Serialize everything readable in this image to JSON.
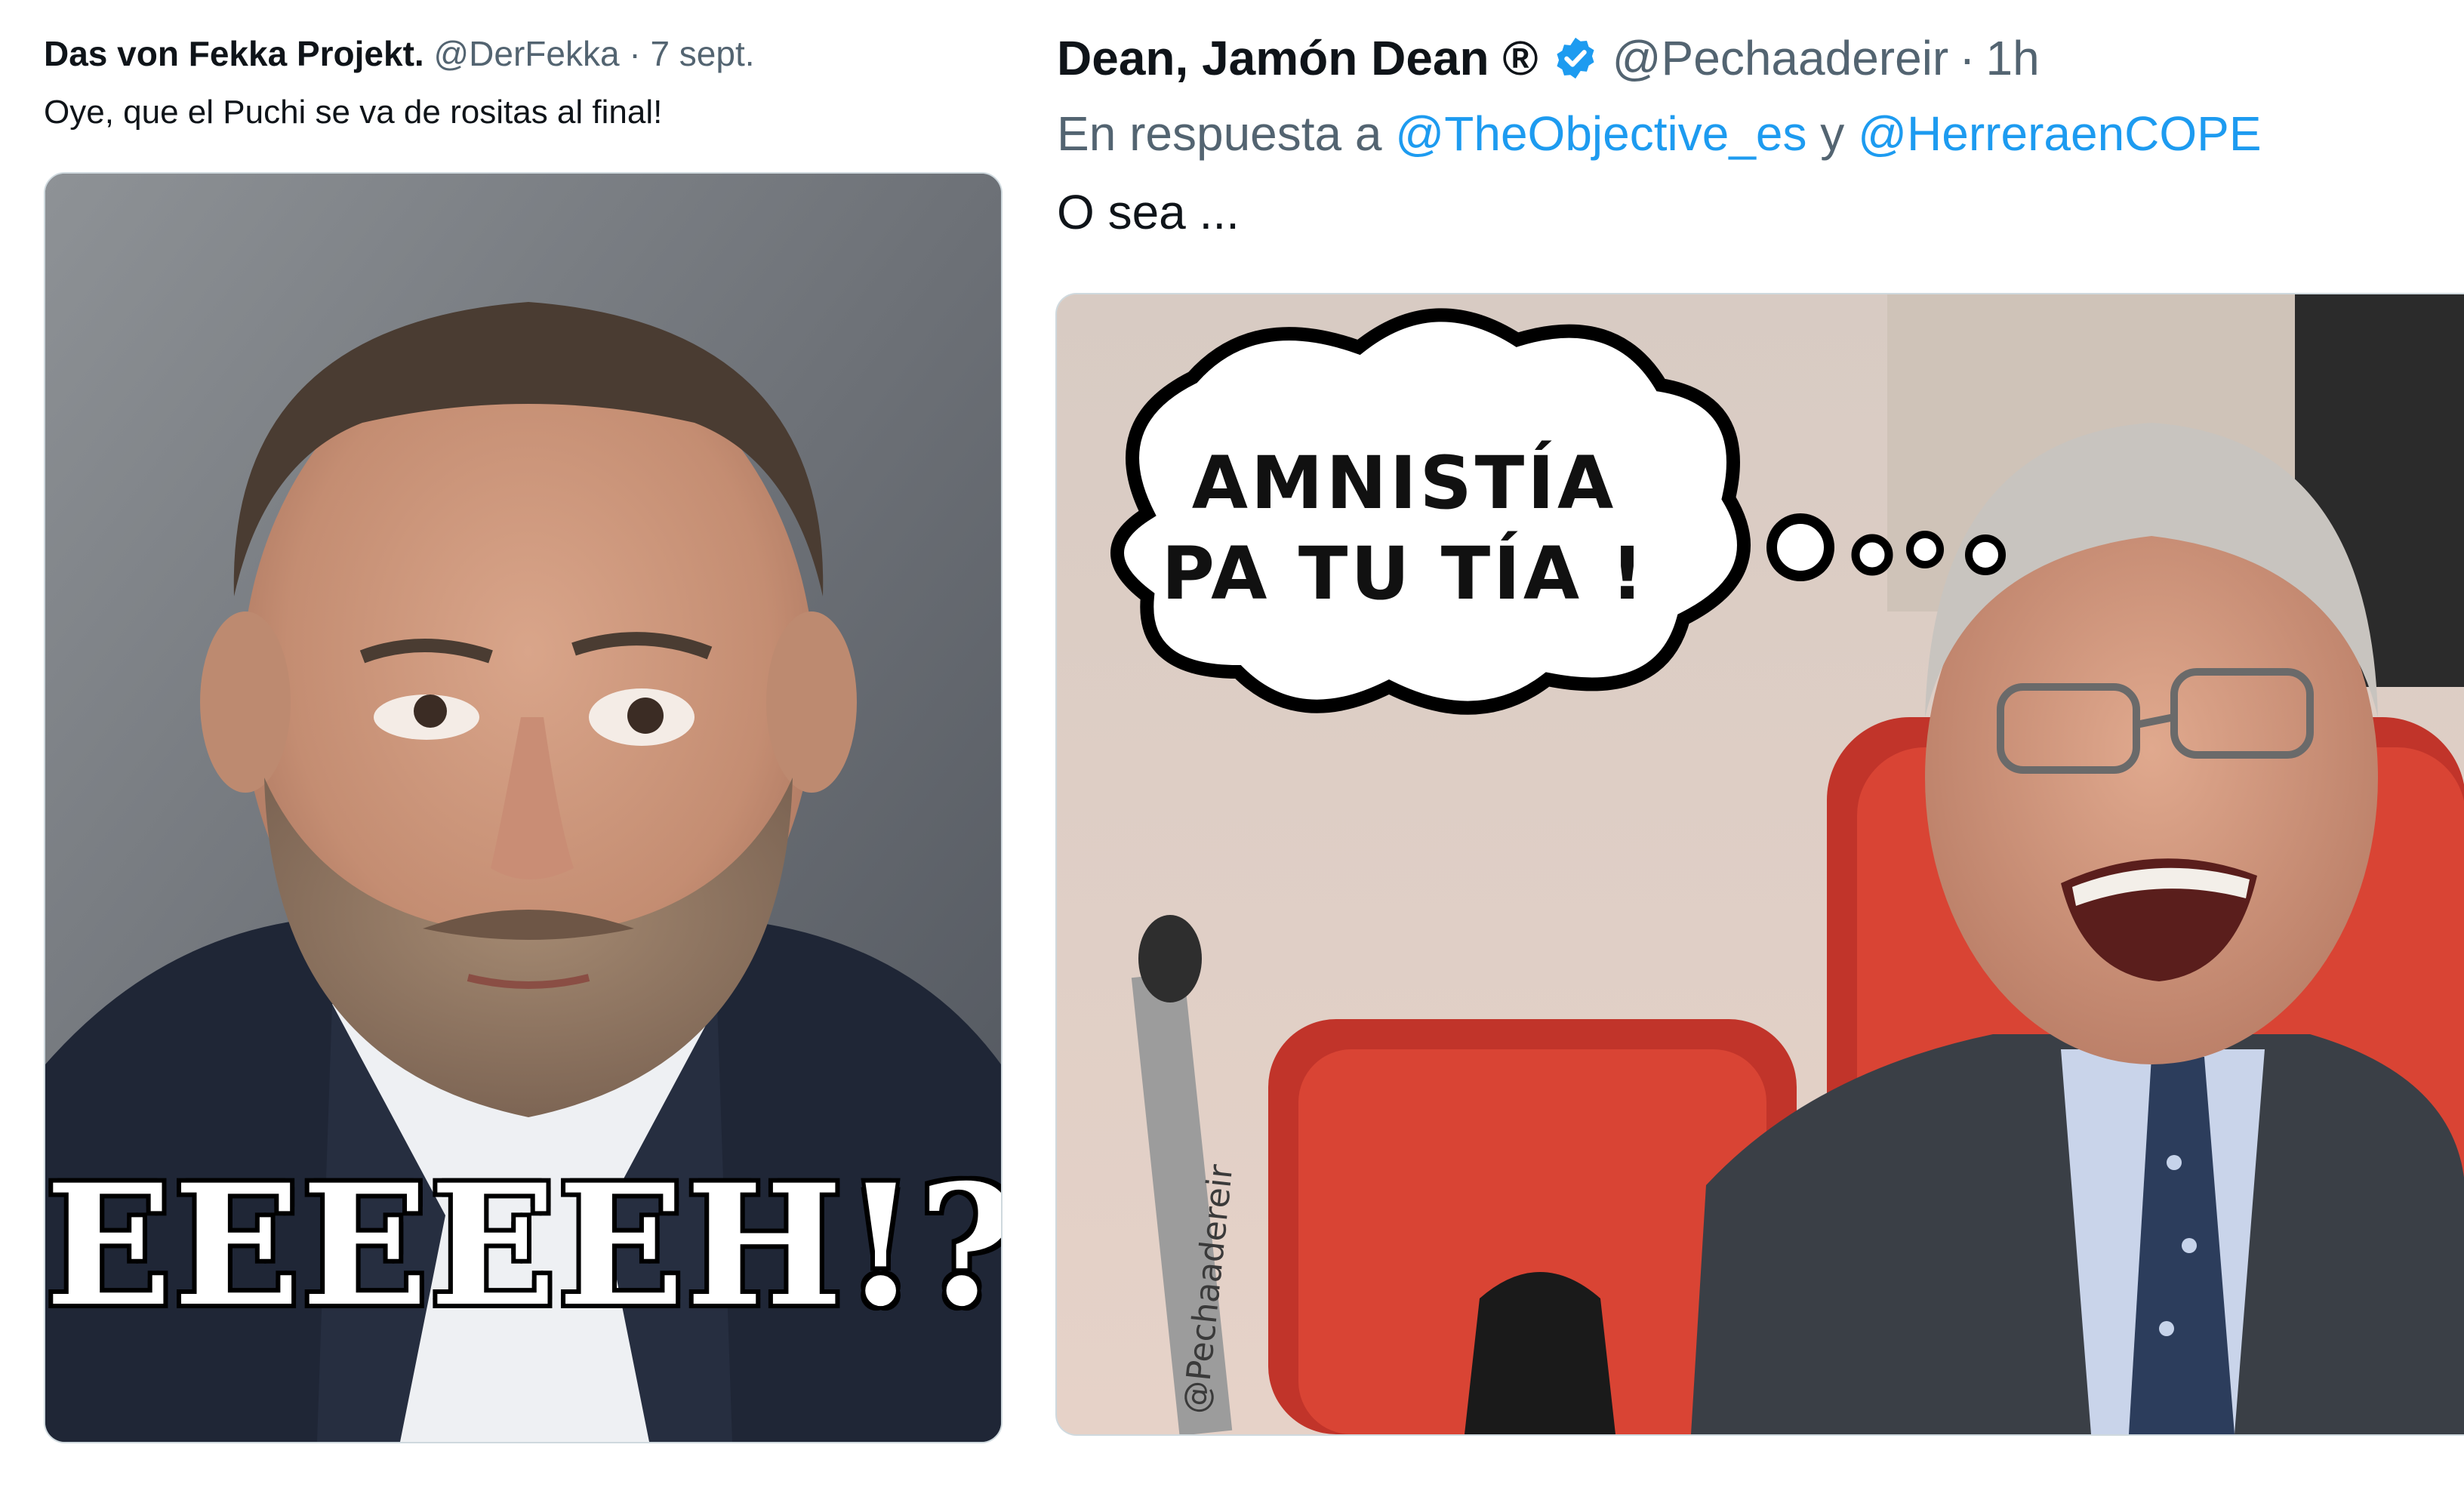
{
  "tweets": [
    {
      "author_name": "Das von Fekka Projekt.",
      "handle": "@DerFekka",
      "separator": "·",
      "timestamp": "7 sept.",
      "text": "Oye, que el Puchi se va de rositas al final!",
      "image": {
        "overlay_text": "EEEEEH!?"
      }
    },
    {
      "author_name": "Dean, Jamón Dean ®",
      "verified": true,
      "handle": "@Pechaadereir",
      "separator": "·",
      "timestamp": "1h",
      "reply_prefix": "En respuesta a",
      "mentions": [
        "@TheObjective_es",
        "@HerreraenCOPE"
      ],
      "mention_joiner": "y",
      "text": "O sea ...",
      "image": {
        "bubble_line1": "AMNISTÍA",
        "bubble_line2": "PA TU TÍA !",
        "watermark": "@Pechaadereir"
      }
    }
  ],
  "colors": {
    "text_primary": "#0f1419",
    "text_secondary": "#536471",
    "link": "#1d9bf0",
    "verified_badge": "#1d9bf0",
    "border": "#cfd9de"
  },
  "icons": [
    "verified-badge-icon"
  ]
}
